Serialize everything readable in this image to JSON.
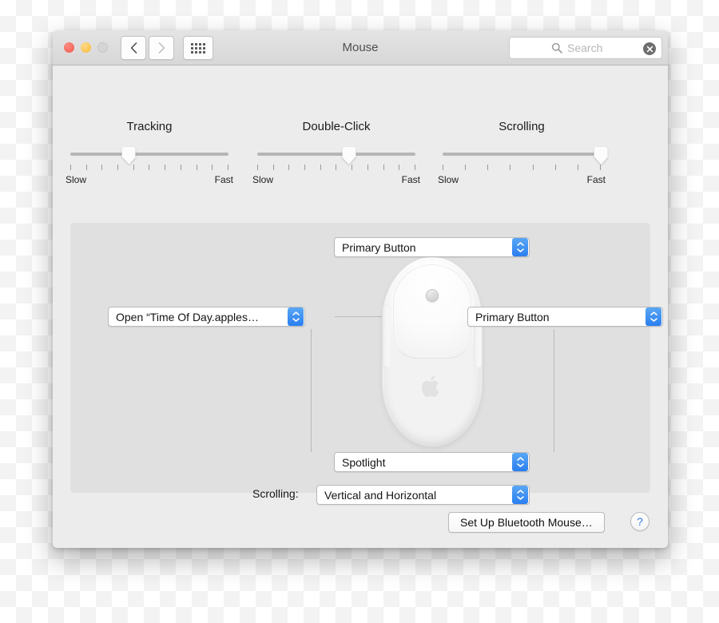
{
  "window": {
    "title": "Mouse",
    "traffic_lights": [
      "close-button",
      "minimize-button",
      "zoom-button-disabled"
    ],
    "nav": {
      "back_icon": "chevron-left-icon",
      "forward_icon": "chevron-right-icon",
      "grid_icon": "show-all-grid-icon"
    },
    "search": {
      "placeholder": "Search",
      "value": "",
      "icon": "search-icon",
      "clear_icon": "clear-icon"
    }
  },
  "sliders": [
    {
      "name": "tracking",
      "title": "Tracking",
      "min_label": "Slow",
      "max_label": "Fast",
      "value_percent": 37,
      "tick_count": 11
    },
    {
      "name": "double-click",
      "title": "Double-Click",
      "min_label": "Slow",
      "max_label": "Fast",
      "value_percent": 58,
      "tick_count": 11
    },
    {
      "name": "scrolling",
      "title": "Scrolling",
      "min_label": "Slow",
      "max_label": "Fast",
      "value_percent": 100,
      "tick_count": 8
    }
  ],
  "panel": {
    "popups": {
      "top_button": {
        "label": "Primary Button",
        "name": "top-button-popup"
      },
      "left_button": {
        "label": "Open “Time Of Day.apples…",
        "name": "left-button-popup"
      },
      "right_button": {
        "label": "Primary Button",
        "name": "right-button-popup"
      },
      "side_buttons": {
        "label": "Spotlight",
        "name": "side-buttons-popup"
      },
      "scrolling": {
        "label": "Vertical and Horizontal",
        "name": "scrolling-popup"
      }
    },
    "scrolling_label": "Scrolling:",
    "mouse": {
      "illustration": "apple-mighty-mouse",
      "scroll_ball": "scroll-ball",
      "logo": "apple-logo"
    }
  },
  "footer": {
    "bluetooth_button": "Set Up Bluetooth Mouse…",
    "help_button": "?"
  },
  "colors": {
    "accent_blue": "#2b7ff0",
    "window_bg": "#ececec",
    "panel_bg": "#e0e0e0",
    "titlebar_bg": "#dcdcdc",
    "close_red": "#f4584f",
    "minimize_yellow": "#f9bb36",
    "zoom_disabled": "#d5d5d5"
  }
}
